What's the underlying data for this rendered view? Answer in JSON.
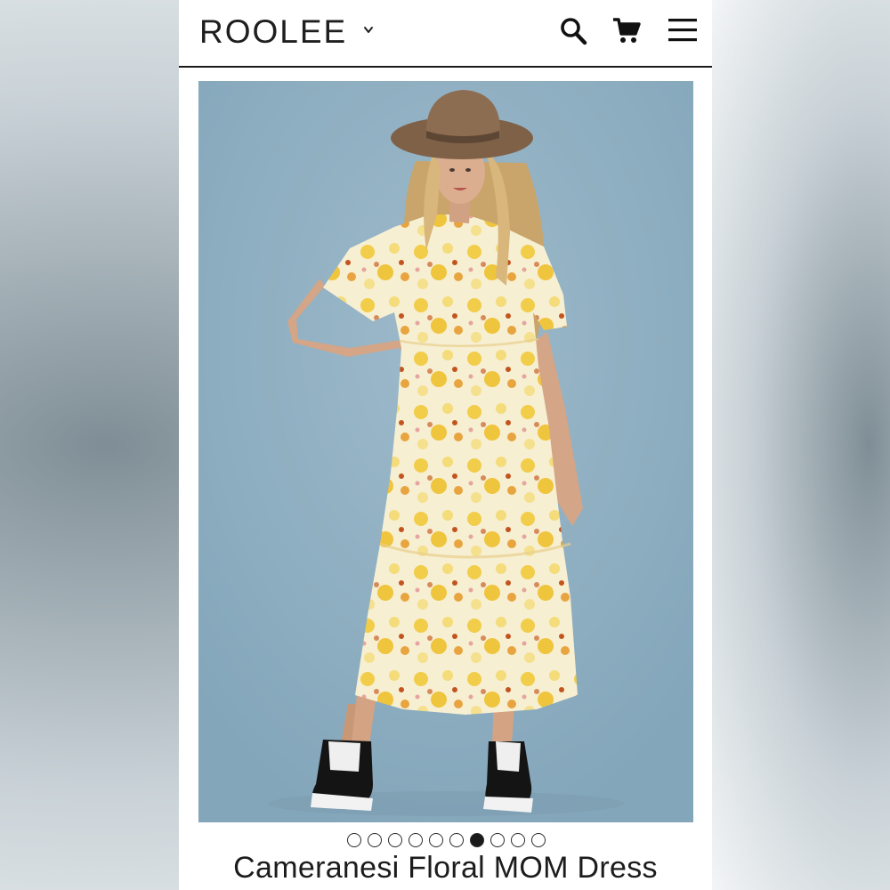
{
  "brand": {
    "logo_text": "ROOLEE"
  },
  "header": {
    "icons": [
      "chevron-down-icon",
      "search-icon",
      "cart-icon",
      "hamburger-menu-icon"
    ]
  },
  "product": {
    "title": "Cameranesi Floral MOM Dress",
    "image_alt": "Model wearing a yellow floral midi dress with a brown wide-brim hat and black sneakers",
    "carousel": {
      "total": 10,
      "active_index": 6
    }
  },
  "colors": {
    "image_background": "#8fb0c3",
    "dress_base": "#f6eccb",
    "dress_flower_yellow": "#f0c93a",
    "dress_flower_orange": "#c2551f",
    "hat": "#8a6c50",
    "text": "#1c1c1c"
  }
}
